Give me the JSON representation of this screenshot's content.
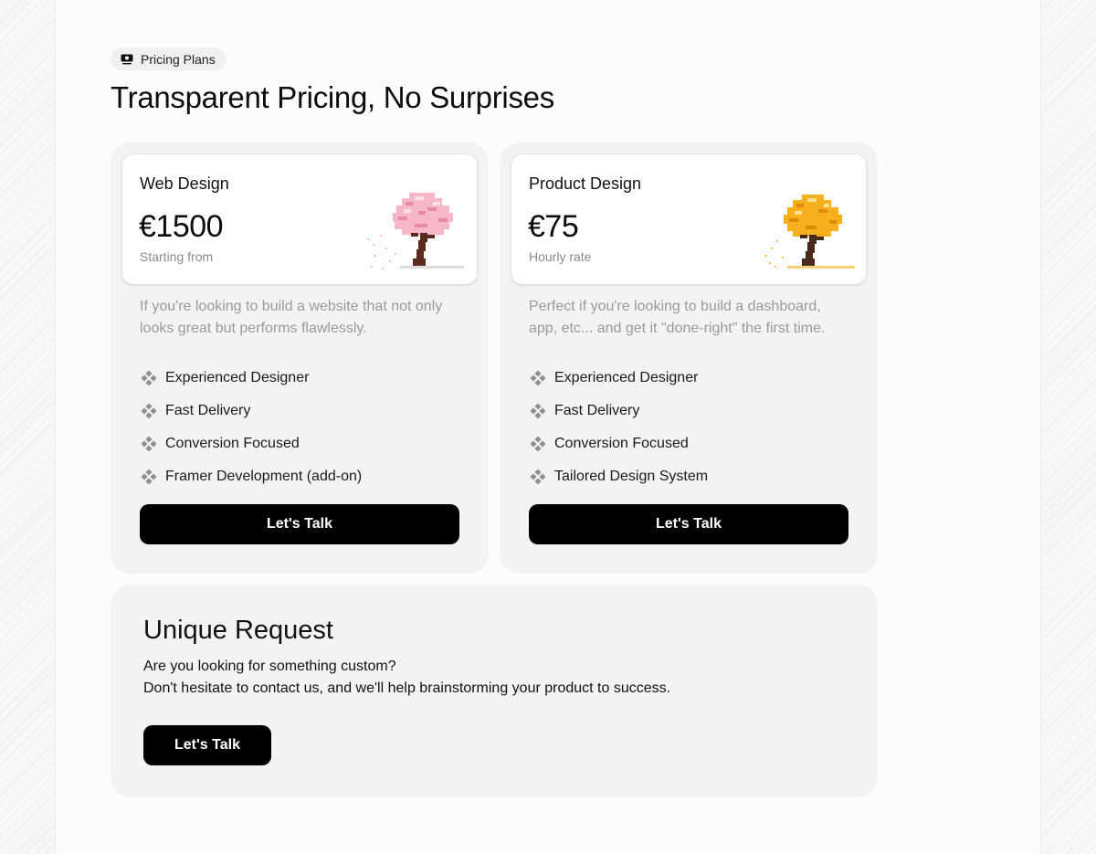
{
  "colors": {
    "page_bg": "#fcfcfc",
    "card_bg": "#f3f3f3",
    "button_bg": "#000000",
    "button_text": "#ffffff",
    "muted_text": "#9a9a9a",
    "pink_tree": "#f4a6bd",
    "gold_tree": "#f5b324"
  },
  "badge": {
    "icon": "money-icon",
    "label": "Pricing Plans"
  },
  "headline": "Transparent Pricing, No Surprises",
  "plans": [
    {
      "name": "Web Design",
      "price": "€1500",
      "price_note": "Starting from",
      "illustration": "pink-pixel-tree-icon",
      "description": "If you're looking to build a website that not only looks great but performs flawlessly.",
      "feature_icon": "diamond-cluster-icon",
      "features": [
        "Experienced Designer",
        "Fast Delivery",
        "Conversion Focused",
        "Framer Development (add-on)"
      ],
      "cta_label": "Let's Talk"
    },
    {
      "name": "Product Design",
      "price": "€75",
      "price_note": "Hourly rate",
      "illustration": "gold-pixel-tree-icon",
      "description": "Perfect if you're looking to build a dashboard, app, etc... and get it \"done-right\" the first time.",
      "feature_icon": "diamond-cluster-icon",
      "features": [
        "Experienced Designer",
        "Fast Delivery",
        "Conversion Focused",
        "Tailored Design System"
      ],
      "cta_label": "Let's Talk"
    }
  ],
  "unique_request": {
    "title": "Unique Request",
    "lines": [
      "Are you looking for something custom?",
      "Don't hesitate to contact us, and we'll help brainstorming your product to success."
    ],
    "cta_label": "Let's Talk"
  }
}
